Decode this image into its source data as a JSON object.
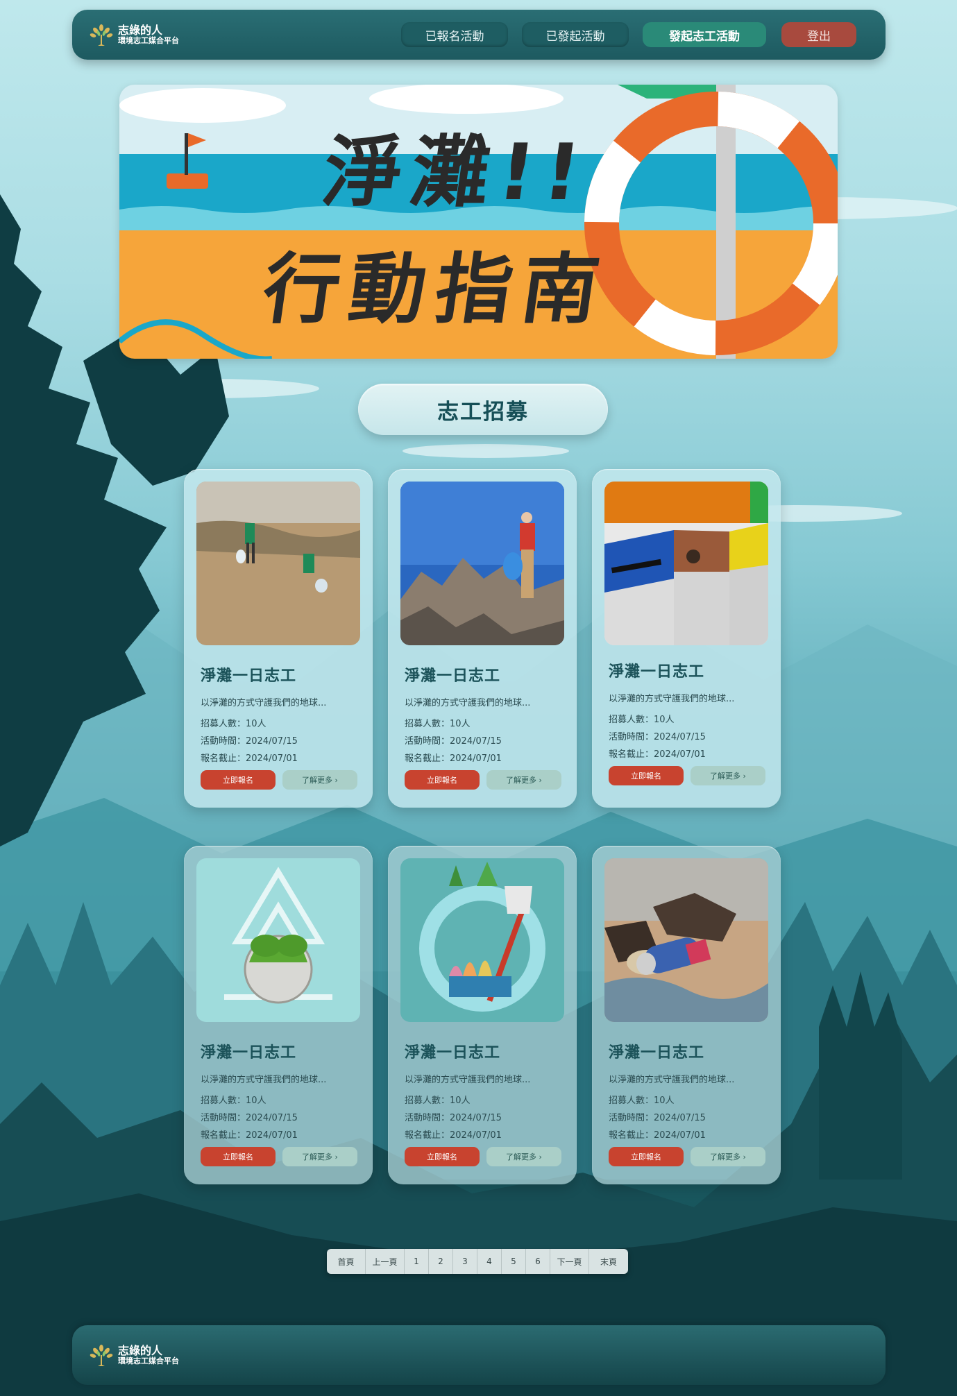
{
  "brand": {
    "title": "志綠的人",
    "subtitle": "環境志工媒合平台"
  },
  "nav": {
    "joined": "已報名活動",
    "created": "已發起活動",
    "launch": "發起志工活動",
    "logout": "登出"
  },
  "banner": {
    "line1": "淨灘!!",
    "line2": "行動指南"
  },
  "section_title": "志工招募",
  "cards": [
    {
      "title": "淨灘一日志工",
      "desc": "以淨灘的方式守護我們的地球...",
      "recruit": "招募人數：10人",
      "date": "活動時間：2024/07/15",
      "deadline": "報名截止：2024/07/01",
      "join": "立即報名",
      "more": "了解更多 ›",
      "image": "beach-cleanup-photo"
    },
    {
      "title": "淨灘一日志工",
      "desc": "以淨灘的方式守護我們的地球...",
      "recruit": "招募人數：10人",
      "date": "活動時間：2024/07/15",
      "deadline": "報名截止：2024/07/01",
      "join": "立即報名",
      "more": "了解更多 ›",
      "image": "mountain-cleanup-photo"
    },
    {
      "title": "淨灘一日志工",
      "desc": "以淨灘的方式守護我們的地球...",
      "recruit": "招募人數：10人",
      "date": "活動時間：2024/07/15",
      "deadline": "報名截止：2024/07/01",
      "join": "立即報名",
      "more": "了解更多 ›",
      "image": "recycling-bins-photo"
    },
    {
      "title": "淨灘一日志工",
      "desc": "以淨灘的方式守護我們的地球...",
      "recruit": "招募人數：10人",
      "date": "活動時間：2024/07/15",
      "deadline": "報名截止：2024/07/01",
      "join": "立即報名",
      "more": "了解更多 ›",
      "image": "recycle-earth-illustration"
    },
    {
      "title": "淨灘一日志工",
      "desc": "以淨灘的方式守護我們的地球...",
      "recruit": "招募人數：10人",
      "date": "活動時間：2024/07/15",
      "deadline": "報名截止：2024/07/01",
      "join": "立即報名",
      "more": "了解更多 ›",
      "image": "eco-hands-illustration"
    },
    {
      "title": "淨灘一日志工",
      "desc": "以淨灘的方式守護我們的地球...",
      "recruit": "招募人數：10人",
      "date": "活動時間：2024/07/15",
      "deadline": "報名截止：2024/07/01",
      "join": "立即報名",
      "more": "了解更多 ›",
      "image": "can-on-shore-photo"
    }
  ],
  "pagination": {
    "first": "首頁",
    "prev": "上一頁",
    "pages": [
      "1",
      "2",
      "3",
      "4",
      "5",
      "6"
    ],
    "next": "下一頁",
    "last": "末頁"
  },
  "colors": {
    "header": "#1d5a60",
    "launch_button": "#2a8a78",
    "logout_button": "#a84a3e",
    "join_button": "#c8432f",
    "more_button": "#aacfc8",
    "card_title": "#1b5259"
  }
}
